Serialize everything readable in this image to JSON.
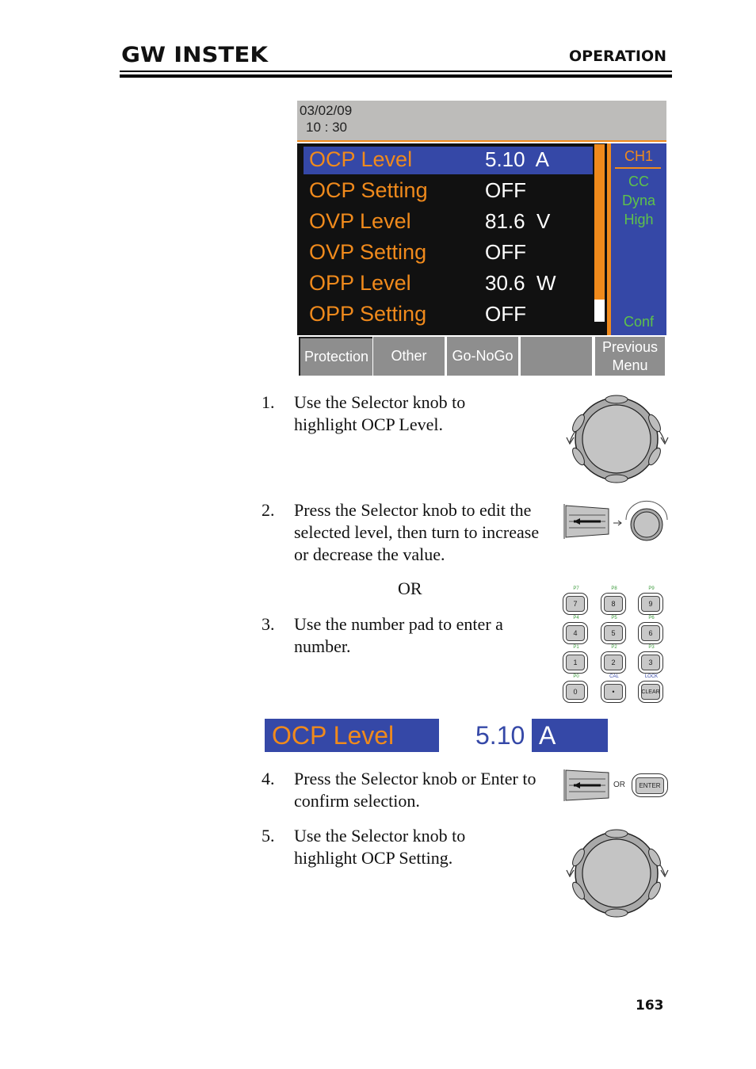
{
  "header": {
    "logo": "GW INSTEK",
    "section": "OPERATION"
  },
  "screen": {
    "date": "03/02/09",
    "time": "10 : 30",
    "rows": [
      {
        "label": "OCP Level",
        "value": "5.10  A",
        "selected": true
      },
      {
        "label": "OCP Setting",
        "value": "OFF",
        "selected": false
      },
      {
        "label": "OVP Level",
        "value": "81.6  V",
        "selected": false
      },
      {
        "label": "OVP Setting",
        "value": "OFF",
        "selected": false
      },
      {
        "label": "OPP Level",
        "value": "30.6  W",
        "selected": false
      },
      {
        "label": "OPP Setting",
        "value": "OFF",
        "selected": false
      }
    ],
    "side": {
      "channel": "CH1",
      "mode_lines": [
        "CC",
        "Dyna",
        "High"
      ],
      "conf": "Conf"
    },
    "softkeys": [
      {
        "label": "Protection",
        "active": true
      },
      {
        "label": "Other",
        "active": false
      },
      {
        "label": "Go-NoGo",
        "active": false
      },
      {
        "label": "",
        "active": false
      },
      {
        "label": "Previous Menu",
        "line1": "Previous",
        "line2": "Menu",
        "active": false
      }
    ],
    "colors": {
      "accent_orange": "#f08a1c",
      "highlight_blue": "#3548a7",
      "status_green": "#5ec24a",
      "softkey_gray": "#8e8e8e"
    }
  },
  "steps": [
    {
      "num": "1.",
      "text": "Use the Selector knob to highlight OCP Level."
    },
    {
      "num": "2.",
      "text": "Press the Selector knob to edit the selected level, then turn to increase or decrease the value."
    },
    {
      "or": "OR"
    },
    {
      "num": "3.",
      "text": "Use the number pad to enter a number."
    },
    {
      "num": "4.",
      "text": "Press the Selector knob or Enter to confirm selection."
    },
    {
      "num": "5.",
      "text": "Use the Selector knob to highlight OCP Setting."
    }
  ],
  "edit_display": {
    "label": "OCP Level",
    "number": "5.10",
    "unit": "A"
  },
  "keypad": {
    "keys": [
      {
        "key": "7",
        "fn": "P7",
        "fn_color": "green"
      },
      {
        "key": "8",
        "fn": "P8",
        "fn_color": "green"
      },
      {
        "key": "9",
        "fn": "P9",
        "fn_color": "green"
      },
      {
        "key": "4",
        "fn": "P4",
        "fn_color": "green"
      },
      {
        "key": "5",
        "fn": "P5",
        "fn_color": "green"
      },
      {
        "key": "6",
        "fn": "P6",
        "fn_color": "green"
      },
      {
        "key": "1",
        "fn": "P1",
        "fn_color": "green"
      },
      {
        "key": "2",
        "fn": "P2",
        "fn_color": "green"
      },
      {
        "key": "3",
        "fn": "P3",
        "fn_color": "green"
      },
      {
        "key": "0",
        "fn": "P0",
        "fn_color": "green"
      },
      {
        "key": "•",
        "fn": "CAL",
        "fn_color": "blue"
      },
      {
        "key": "CLEAR",
        "fn": "LOCK",
        "fn_color": "blue"
      }
    ]
  },
  "confirm_icons": {
    "or": "OR",
    "enter": "ENTER"
  },
  "footer": {
    "page_number": "163"
  }
}
